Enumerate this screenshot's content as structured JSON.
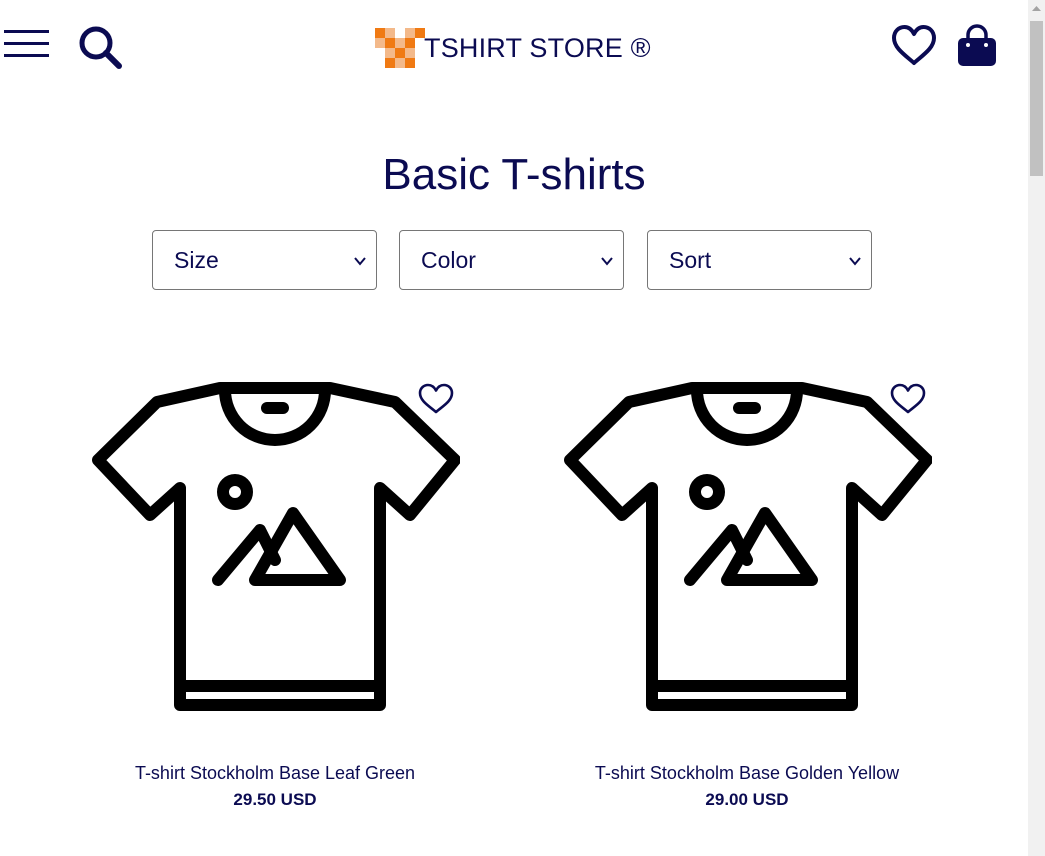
{
  "header": {
    "brand_name": "TSHIRT STORE ®",
    "icons": [
      "menu-icon",
      "search-icon",
      "heart-icon",
      "shopping-bag-icon"
    ]
  },
  "page": {
    "title": "Basic T-shirts"
  },
  "filters": {
    "size_label": "Size",
    "color_label": "Color",
    "sort_label": "Sort"
  },
  "products": [
    {
      "name": "T-shirt Stockholm Base Leaf Green",
      "price": "29.50 USD"
    },
    {
      "name": "T-shirt Stockholm Base Golden Yellow",
      "price": "29.00 USD"
    }
  ],
  "colors": {
    "text": "#0b0b52",
    "logo_orange": "#f07a13",
    "logo_light": "#f3b98a",
    "background": "#ffffff"
  }
}
